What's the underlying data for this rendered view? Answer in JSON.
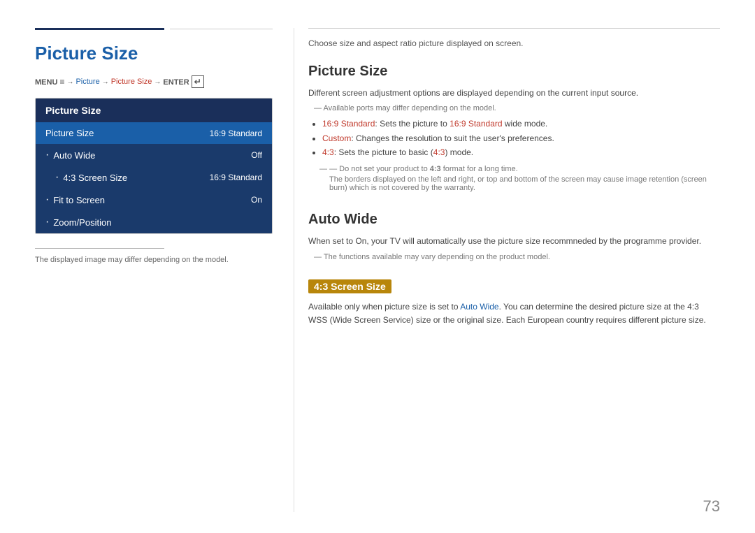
{
  "left": {
    "pageTitle": "Picture Size",
    "breadcrumb": {
      "menu": "MENU",
      "menuSymbol": "≡",
      "arrow1": "→",
      "item1": "Picture",
      "arrow2": "→",
      "item2": "Picture Size",
      "arrow3": "→",
      "item4": "ENTER",
      "enterSymbol": "↵"
    },
    "menuBox": {
      "header": "Picture Size",
      "items": [
        {
          "label": "Picture Size",
          "value": "16:9 Standard",
          "indent": false,
          "dot": false
        },
        {
          "label": "Auto Wide",
          "value": "Off",
          "indent": false,
          "dot": true
        },
        {
          "label": "4:3 Screen Size",
          "value": "16:9 Standard",
          "indent": true,
          "dot": true
        },
        {
          "label": "Fit to Screen",
          "value": "On",
          "indent": false,
          "dot": true
        },
        {
          "label": "Zoom/Position",
          "value": "",
          "indent": false,
          "dot": true
        }
      ]
    },
    "note": "The displayed image may differ depending on the model."
  },
  "right": {
    "intro": "Choose size and aspect ratio picture displayed on screen.",
    "sections": [
      {
        "id": "picture-size",
        "title": "Picture Size",
        "body": "Different screen adjustment options are displayed depending on the current input source.",
        "noteLines": [
          "Available ports may differ depending on the model."
        ],
        "bullets": [
          {
            "label": "16:9 Standard",
            "labelColor": "red",
            "text": ": Sets the picture to ",
            "highlight": "16:9 Standard",
            "highlightColor": "red",
            "rest": " wide mode."
          },
          {
            "label": "Custom",
            "labelColor": "red",
            "text": ": Changes the resolution to suit the user's preferences.",
            "highlight": "",
            "rest": ""
          },
          {
            "label": "4:3",
            "labelColor": "red",
            "text": ": Sets the picture to basic (",
            "highlight": "4:3",
            "highlightColor": "red",
            "rest": ") mode."
          }
        ],
        "subNotes": [
          "Do not set your product to 4:3 format for a long time.",
          "The borders displayed on the left and right, or top and bottom of the screen may cause image retention (screen burn) which is not covered by the warranty."
        ]
      },
      {
        "id": "auto-wide",
        "title": "Auto Wide",
        "body": "When set to On, your TV will automatically use the picture size recommneded by the programme provider.",
        "noteLines": [
          "The functions available may vary depending on the product model."
        ]
      },
      {
        "id": "43-screen-size",
        "titleHighlighted": "4:3 Screen Size",
        "body1": "Available only when picture size is set to ",
        "body1Link": "Auto Wide",
        "body2": ". You can determine the desired picture size at the 4:3 WSS (Wide Screen Service) size or the original size. Each European country requires different picture size."
      }
    ],
    "pageNumber": "73"
  }
}
